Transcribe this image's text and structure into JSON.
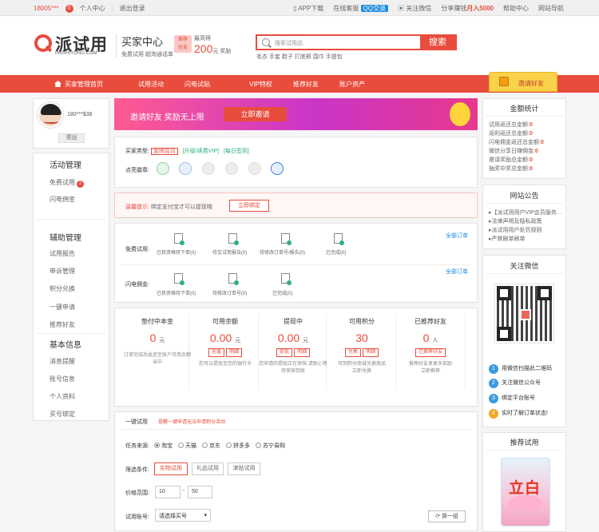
{
  "topbar": {
    "user": "18005***",
    "msg_count": "0",
    "personal_center": "个人中心",
    "logout": "退出登录",
    "app_download": "APP下载",
    "online_service": "在线客服",
    "qq_chat": "QQ交谈",
    "follow_wechat": "关注微信",
    "share_earn_prefix": "分享赚钱",
    "share_earn_amount": "月入5000",
    "help_center": "帮助中心",
    "site_nav": "网站导航"
  },
  "header": {
    "logo_name": "派试用",
    "logo_en": "PAISHIYONG.COM",
    "center_title": "买家中心",
    "center_sub": "免费试用 超淘通话单",
    "invite_badge_1": "推荐",
    "invite_badge_2": "好友",
    "reward_prefix": "最高得",
    "reward_amount": "200",
    "reward_suffix": "元 奖励",
    "search_placeholder": "搜索试用品",
    "search_button": "搜索",
    "hot_words": "毛衣 手套 鞋子 打底裤 围巾 手提包"
  },
  "nav": {
    "items": [
      "买家管理首页",
      "试用活动",
      "闪电试贴",
      "VIP特权",
      "推荐好友",
      "账户资产"
    ],
    "invite_tab": "邀请好友"
  },
  "sidebar": {
    "username": "180***$38",
    "logout_btn": "退出",
    "sections": [
      {
        "title": "活动管理",
        "items": [
          "免费试用",
          "闪电佣金"
        ]
      },
      {
        "title": "辅助管理",
        "items": [
          "试用报告",
          "申诉管理",
          "积分兑换",
          "一键申请",
          "推荐好友"
        ]
      },
      {
        "title": "基本信息",
        "items": [
          "消息提醒",
          "账号信息",
          "个人资料",
          "买号绑定"
        ]
      }
    ],
    "free_trial_badge": "2"
  },
  "banner": {
    "text": "邀请好友  奖励无上限",
    "button": "立即邀请"
  },
  "account": {
    "type_label": "买家类型:",
    "type_value": "金牌会员",
    "upgrade": "[升级/续费VIP]",
    "daily_sign": "[每日签到]",
    "badges_label": "点亮徽章:"
  },
  "tip": {
    "label": "温馨提示:",
    "text": "绑定支付宝才可以提现哦",
    "button": "立即绑定"
  },
  "orders": {
    "free_label": "免费试用:",
    "all_orders": "全部订单",
    "free_items": [
      "已获资格待下单(0)",
      "待交试用报告(0)",
      "待修改订单号/报告(0)",
      "已完成(0)"
    ],
    "flash_label": "闪电佣金:",
    "flash_items": [
      "已获资格待下单(0)",
      "待修改订单号(0)",
      "已完成(0)"
    ]
  },
  "stats": [
    {
      "title": "垫付中本金",
      "value": "0",
      "unit": "元",
      "desc": "订单完成后返还至账户可用余额当中",
      "buttons": [],
      "link": ""
    },
    {
      "title": "可用余额",
      "value": "0.00",
      "unit": "元",
      "desc": "您可以提现至您的银行卡",
      "buttons": [
        "充值",
        "明细"
      ],
      "link": ""
    },
    {
      "title": "提现中",
      "value": "0.00",
      "unit": "元",
      "desc": "您申请的提现正在审核,请耐心等待审核到账",
      "buttons": [
        "提现",
        "明细"
      ],
      "link": ""
    },
    {
      "title": "可用积分",
      "value": "30",
      "unit": "",
      "desc": "可到积分商城兑换商品",
      "buttons": [
        "兑换",
        "明细"
      ],
      "link": "立即兑换"
    },
    {
      "title": "已推荐好友",
      "value": "0",
      "unit": "人",
      "desc": "推荐好友享更多奖励",
      "buttons": [
        "已推荐好友"
      ],
      "link": "立即推荐"
    }
  ],
  "quick": {
    "title": "一键试用",
    "hint": "提醒一键申请无法申请积分活动",
    "source_label": "任务来源:",
    "sources": [
      "淘宝",
      "天猫",
      "京东",
      "拼多多",
      "苏宁易购"
    ],
    "filter_label": "筛选条件:",
    "filters": [
      "实物试用",
      "礼品试用",
      "津贴试用"
    ],
    "price_label": "价格范围:",
    "price_min": "10",
    "price_max": "50",
    "account_label": "试用账号:",
    "account_select": "请选择买号",
    "refresh": "换一组"
  },
  "right": {
    "stats_title": "金额统计",
    "stats_items": [
      "试用返还总金额:",
      "返利返还总金额:",
      "闪电佣金返还总金额:",
      "微信分享日赚佣金:",
      "邀请奖励总金额:",
      "抽奖中奖总金额:"
    ],
    "stats_values": [
      "0",
      "0",
      "0",
      "0",
      "0",
      "0"
    ],
    "notice_title": "网站公告",
    "notices": [
      "【派试用用户VIP会员服务...",
      "法律声明及隐私政策",
      "派试用用户处罚规则",
      "严禁刷单刷单"
    ],
    "wechat_title": "关注微信",
    "steps": [
      "用微信扫描此二维码",
      "关注微信公众号",
      "绑定平台账号",
      "实时了解订单状态!"
    ],
    "recommend_title": "推荐试用",
    "product_brand": "立白"
  }
}
